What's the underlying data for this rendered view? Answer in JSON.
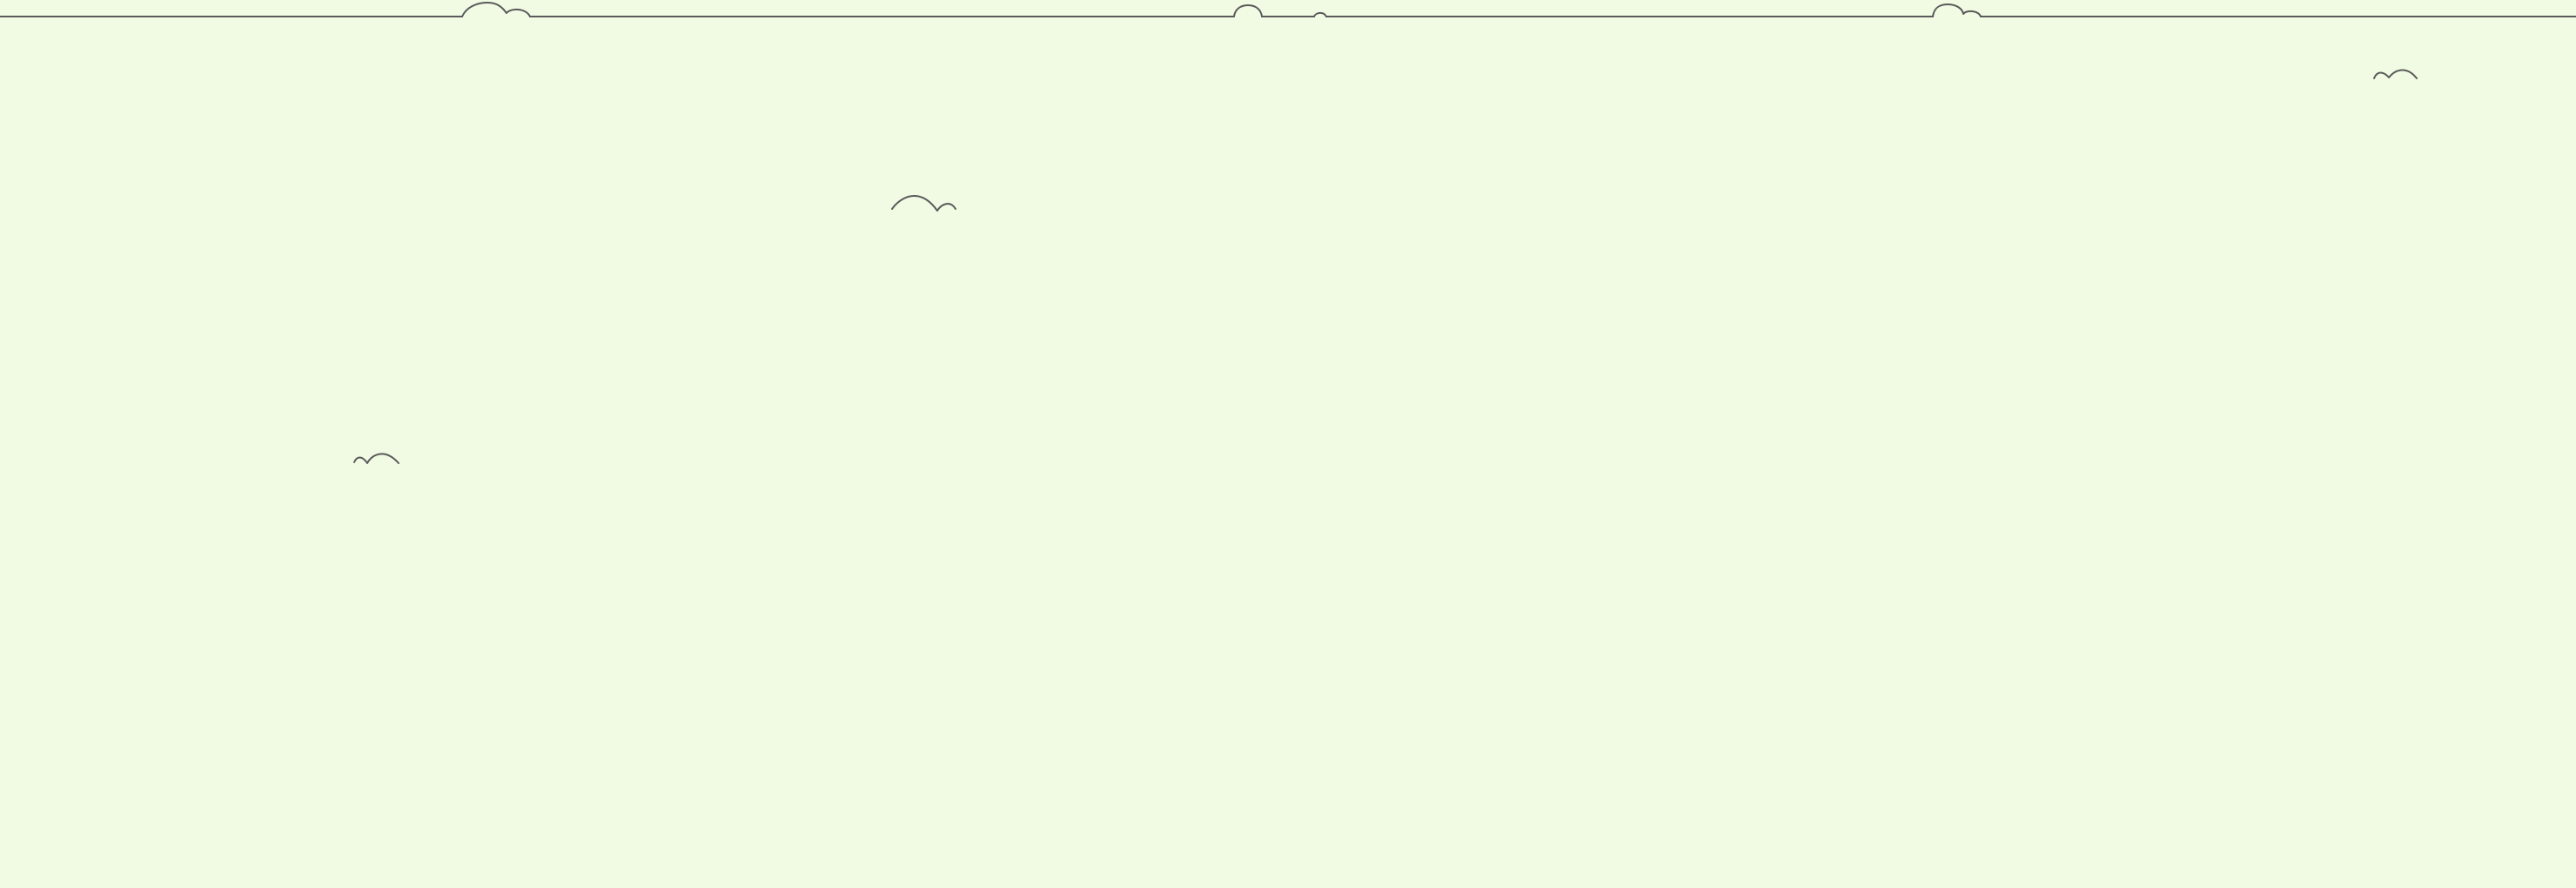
{
  "colors": {
    "background": "#f1fbe4",
    "line": "#5a5a5a"
  },
  "scene": {
    "horizon_line": true,
    "bush_count": 5,
    "bird_count": 3
  }
}
